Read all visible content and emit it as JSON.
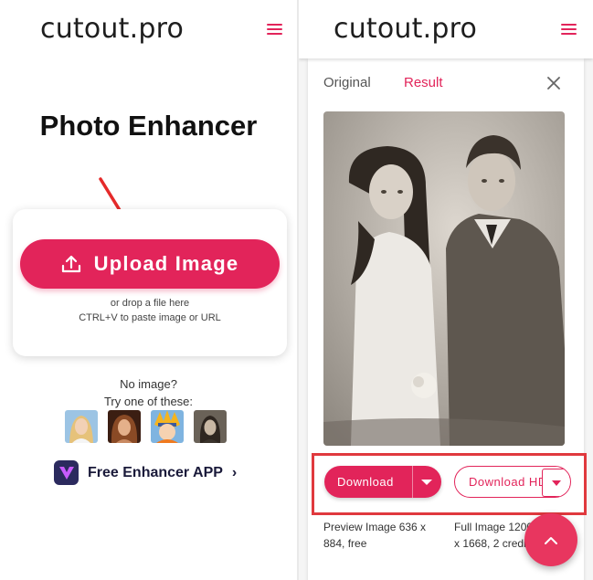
{
  "left": {
    "logo": "cutout.pro",
    "title": "Photo Enhancer",
    "upload_label": "Upload Image",
    "drop_line1": "or drop a file here",
    "drop_line2": "CTRL+V to paste image or URL",
    "no_image": "No image?",
    "try_one": "Try one of these:",
    "app_link": "Free Enhancer APP",
    "app_chevron": "›"
  },
  "right": {
    "logo": "cutout.pro",
    "tabs": {
      "original": "Original",
      "result": "Result"
    },
    "download_label": "Download",
    "download_hd_label": "Download HD",
    "preview_info": "Preview Image 636 x 884, free",
    "full_info": "Full Image 1200 x 1668, 2 credits"
  },
  "colors": {
    "accent": "#e2245a",
    "highlight": "#e0393e"
  },
  "icons": [
    "menu-icon",
    "upload-icon",
    "app-icon",
    "chevron-right-icon",
    "close-icon",
    "caret-down-icon",
    "chevron-up-icon"
  ]
}
